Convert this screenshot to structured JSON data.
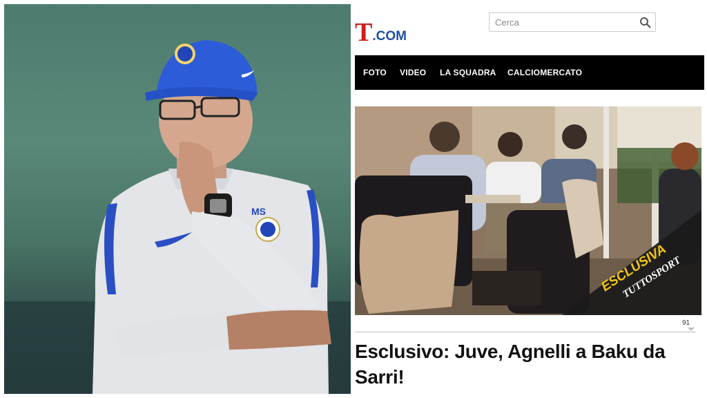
{
  "site": {
    "logo_mark": "T",
    "logo_suffix": ".COM",
    "search": {
      "placeholder": "Cerca"
    }
  },
  "nav": {
    "items": [
      {
        "label": "FOTO"
      },
      {
        "label": "VIDEO"
      },
      {
        "label": "LA SQUADRA"
      },
      {
        "label": "CALCIOMERCATO"
      }
    ]
  },
  "photo_overlay": {
    "badge_text": "ESCLUSIVA",
    "badge_brand": "TUTTOSPORT"
  },
  "left_photo": {
    "shirt_initials": "MS"
  },
  "article": {
    "comment_count": "91",
    "headline_line1": "Esclusivo: Juve, Agnelli a Baku da",
    "headline_line2": "Sarri!"
  },
  "icons": {
    "search": "magnifier-icon",
    "swoosh": "swoosh-logo",
    "crest": "lion-crest"
  },
  "colors": {
    "logo_red": "#d11c1c",
    "logo_blue": "#1f4fa0",
    "nav_bg": "#000000",
    "badge_yellow": "#f2c512"
  }
}
